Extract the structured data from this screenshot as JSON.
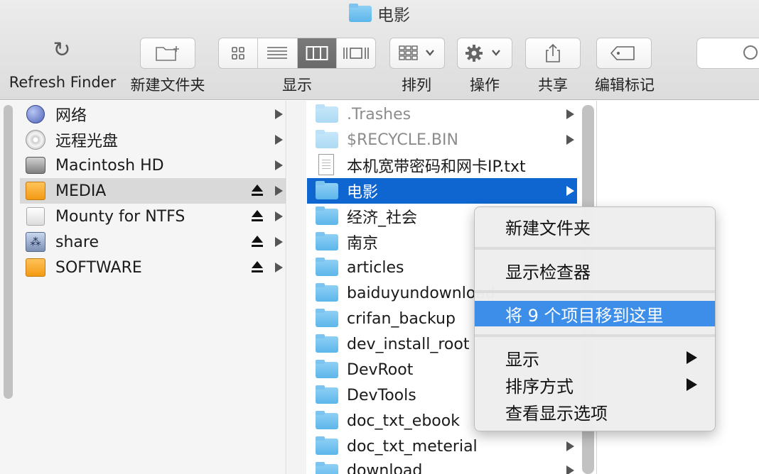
{
  "window": {
    "title": "电影",
    "title_icon": "folder-icon"
  },
  "toolbar": {
    "refresh_label": "Refresh Finder",
    "new_folder_label": "新建文件夹",
    "view_label": "显示",
    "arrange_label": "排列",
    "action_label": "操作",
    "share_label": "共享",
    "tags_label": "编辑标记",
    "view_modes": [
      "icon-view",
      "list-view",
      "column-view",
      "cover-flow-view"
    ],
    "active_view": "column-view"
  },
  "sidebar": {
    "items": [
      {
        "label": "网络",
        "icon": "network-globe-icon",
        "eject": false,
        "selected": false
      },
      {
        "label": "远程光盘",
        "icon": "remote-disc-icon",
        "eject": false,
        "selected": false
      },
      {
        "label": "Macintosh HD",
        "icon": "hard-disk-icon",
        "eject": false,
        "selected": false
      },
      {
        "label": "MEDIA",
        "icon": "external-drive-icon",
        "eject": true,
        "selected": true
      },
      {
        "label": "Mounty for NTFS",
        "icon": "external-drive-icon",
        "eject": true,
        "selected": false
      },
      {
        "label": "share",
        "icon": "network-share-icon",
        "eject": true,
        "selected": false
      },
      {
        "label": "SOFTWARE",
        "icon": "external-drive-icon",
        "eject": true,
        "selected": false
      }
    ]
  },
  "column2": {
    "items": [
      {
        "label": ".Trashes",
        "kind": "folder",
        "dim": true,
        "arrow": true
      },
      {
        "label": "$RECYCLE.BIN",
        "kind": "folder",
        "dim": true,
        "arrow": true
      },
      {
        "label": "本机宽带密码和网卡IP.txt",
        "kind": "text-file",
        "dim": false,
        "arrow": false
      },
      {
        "label": "电影",
        "kind": "folder",
        "dim": false,
        "arrow": true,
        "selected": true
      },
      {
        "label": "经济_社会",
        "kind": "folder",
        "dim": false,
        "arrow": false
      },
      {
        "label": "南京",
        "kind": "folder",
        "dim": false,
        "arrow": false
      },
      {
        "label": "articles",
        "kind": "folder",
        "dim": false,
        "arrow": false
      },
      {
        "label": "baiduyundownload",
        "kind": "folder",
        "dim": false,
        "arrow": false
      },
      {
        "label": "crifan_backup",
        "kind": "folder",
        "dim": false,
        "arrow": false
      },
      {
        "label": "dev_install_root",
        "kind": "folder",
        "dim": false,
        "arrow": false
      },
      {
        "label": "DevRoot",
        "kind": "folder",
        "dim": false,
        "arrow": false
      },
      {
        "label": "DevTools",
        "kind": "folder",
        "dim": false,
        "arrow": false
      },
      {
        "label": "doc_txt_ebook",
        "kind": "folder",
        "dim": false,
        "arrow": false
      },
      {
        "label": "doc_txt_meterial",
        "kind": "folder",
        "dim": false,
        "arrow": true
      },
      {
        "label": "download",
        "kind": "folder",
        "dim": false,
        "arrow": true
      }
    ]
  },
  "context_menu": {
    "new_folder": "新建文件夹",
    "show_inspector": "显示检查器",
    "move_items": "将 9 个项目移到这里",
    "show": "显示",
    "sort_by": "排序方式",
    "view_options": "查看显示选项"
  },
  "colors": {
    "selection_blue": "#0f66d0",
    "menu_highlight": "#3c8ee8",
    "folder_blue": "#5cb6ea",
    "sidebar_selected": "#d9d9d9"
  }
}
